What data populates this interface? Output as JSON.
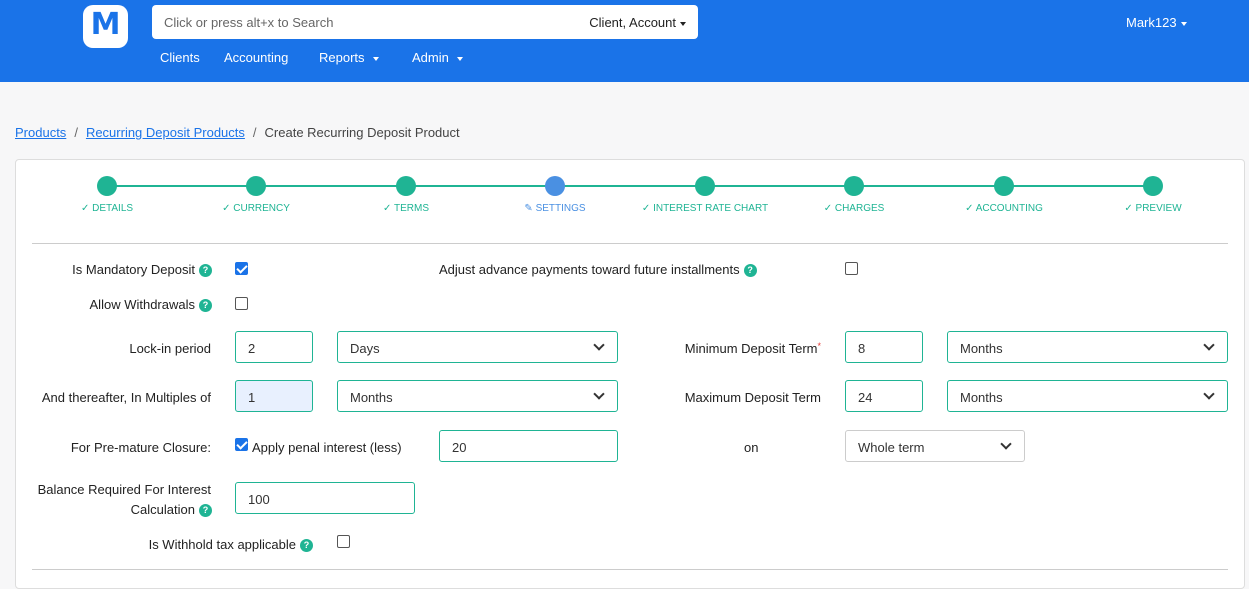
{
  "header": {
    "logo_letter": "M",
    "search_placeholder": "Click or press alt+x to Search",
    "search_scope": "Client, Account",
    "user": "Mark123",
    "nav": [
      "Clients",
      "Accounting",
      "Reports",
      "Admin"
    ]
  },
  "breadcrumb": {
    "items": [
      "Products",
      "Recurring Deposit Products"
    ],
    "current": "Create Recurring Deposit Product"
  },
  "stepper": {
    "steps": [
      "DETAILS",
      "CURRENCY",
      "TERMS",
      "SETTINGS",
      "INTEREST RATE CHART",
      "CHARGES",
      "ACCOUNTING",
      "PREVIEW"
    ],
    "active_index": 3
  },
  "form": {
    "is_mandatory_deposit": {
      "label": "Is Mandatory Deposit",
      "checked": true
    },
    "adjust_advance": {
      "label": "Adjust advance payments toward future installments",
      "checked": false
    },
    "allow_withdrawals": {
      "label": "Allow Withdrawals",
      "checked": false
    },
    "lock_in": {
      "label": "Lock-in period",
      "value": "2",
      "unit": "Days"
    },
    "min_deposit_term": {
      "label": "Minimum Deposit Term",
      "required_mark": "*",
      "value": "8",
      "unit": "Months"
    },
    "multiples": {
      "label": "And thereafter, In Multiples of",
      "value": "1",
      "unit": "Months"
    },
    "max_deposit_term": {
      "label": "Maximum Deposit Term",
      "value": "24",
      "unit": "Months"
    },
    "premature": {
      "label": "For Pre-mature Closure:",
      "penal_label": "Apply penal interest (less)",
      "penal_checked": true,
      "penal_value": "20",
      "on_label": "on",
      "on_value": "Whole term"
    },
    "balance_required": {
      "label_line1": "Balance Required For Interest",
      "label_line2": "Calculation",
      "value": "100"
    },
    "withhold_tax": {
      "label": "Is Withhold tax applicable",
      "checked": false
    }
  },
  "colors": {
    "brand": "#1a73e8",
    "accent": "#1fb494",
    "active_step": "#4a90e2"
  }
}
